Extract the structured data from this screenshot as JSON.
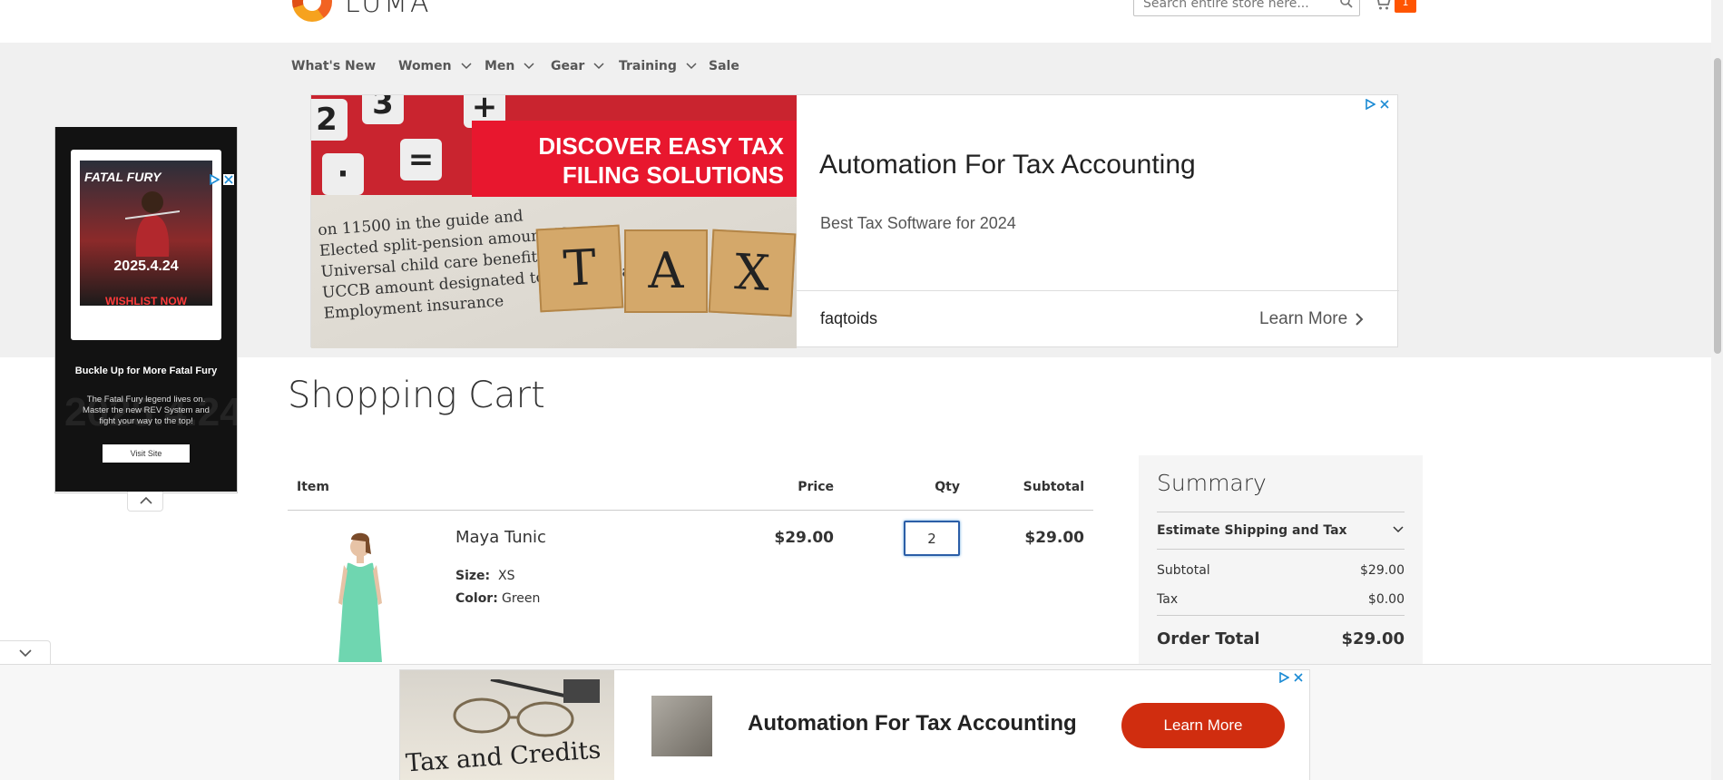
{
  "header": {
    "logo_text": "LUMA",
    "search_placeholder": "Search entire store here...",
    "cart_count": "1"
  },
  "nav": {
    "items": [
      {
        "label": "What's New",
        "has_dropdown": false
      },
      {
        "label": "Women",
        "has_dropdown": true
      },
      {
        "label": "Men",
        "has_dropdown": true
      },
      {
        "label": "Gear",
        "has_dropdown": true
      },
      {
        "label": "Training",
        "has_dropdown": true
      },
      {
        "label": "Sale",
        "has_dropdown": false
      }
    ]
  },
  "top_ad": {
    "banner_line1": "DISCOVER EASY TAX",
    "banner_line2": "FILING SOLUTIONS",
    "headline": "Automation For Tax Accounting",
    "subtext": "Best Tax Software for 2024",
    "brand": "faqtoids",
    "cta": "Learn More"
  },
  "side_ad": {
    "poster_title": "FATAL FURY",
    "date": "2025.4.24",
    "wishlist": "WISHLIST NOW",
    "heading": "Buckle Up for More Fatal Fury",
    "body": "The Fatal Fury legend lives on. Master the new REV System and fight your way to the top!",
    "button": "Visit Site"
  },
  "page": {
    "title": "Shopping Cart"
  },
  "cart": {
    "columns": {
      "item": "Item",
      "price": "Price",
      "qty": "Qty",
      "subtotal": "Subtotal"
    },
    "items": [
      {
        "name": "Maya Tunic",
        "size_label": "Size:",
        "size": "XS",
        "color_label": "Color:",
        "color": "Green",
        "price": "$29.00",
        "qty": "2",
        "subtotal": "$29.00"
      }
    ]
  },
  "summary": {
    "title": "Summary",
    "estimate_label": "Estimate Shipping and Tax",
    "subtotal_label": "Subtotal",
    "subtotal_value": "$29.00",
    "tax_label": "Tax",
    "tax_value": "$0.00",
    "order_total_label": "Order Total",
    "order_total_value": "$29.00"
  },
  "bottom_ad": {
    "image_text": "Tax and Credits",
    "headline": "Automation For Tax Accounting",
    "cta": "Learn More"
  },
  "colors": {
    "accent": "#ff5501",
    "nav_bg": "#f0f0f0",
    "qty_focus": "#2b5ea7",
    "ad_cta": "#d02d0f",
    "product_green": "#6fd6b0"
  },
  "icons": [
    "search-icon",
    "cart-icon",
    "chevron-down-icon",
    "adchoices-icon",
    "close-icon",
    "chevron-up-icon",
    "chevron-right-icon"
  ]
}
